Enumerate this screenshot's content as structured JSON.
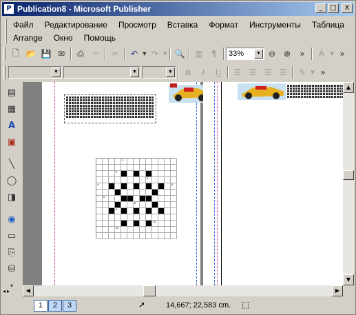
{
  "window": {
    "title": "Publication8 - Microsoft Publisher",
    "app_icon": "publisher-app-icon",
    "minimize_label": "_",
    "maximize_label": "□",
    "close_label": "X"
  },
  "menu": {
    "row1": [
      "Файл",
      "Редактирование",
      "Просмотр",
      "Вставка",
      "Формат",
      "Инструменты",
      "Таблица"
    ],
    "row2": [
      "Arrange",
      "Окно",
      "Помощь"
    ]
  },
  "toolbar_standard": {
    "zoom_value": "33%",
    "overflow": "»"
  },
  "toolbar_format": {
    "style_value": "",
    "font_value": "",
    "size_value": "",
    "bold": "B",
    "italic": "I",
    "underline": "U",
    "overflow": "»"
  },
  "crossword": {
    "numbers": {
      "0_4": "1",
      "2_3": "2",
      "3_8": "3",
      "4_0": "4",
      "4_12": "5",
      "6_1": "6",
      "6_7": "7",
      "7_6": "8",
      "8_3": "9",
      "10_9": "10",
      "11_3": "11"
    }
  },
  "status": {
    "pages": [
      "1",
      "2",
      "3"
    ],
    "active_page": "1",
    "coordinates": "14,667; 22,583 cm."
  },
  "colors": {
    "title_start": "#0a246a",
    "title_end": "#a6caf0",
    "guide_pink": "#e040a0",
    "guide_blue": "#4060e0"
  }
}
